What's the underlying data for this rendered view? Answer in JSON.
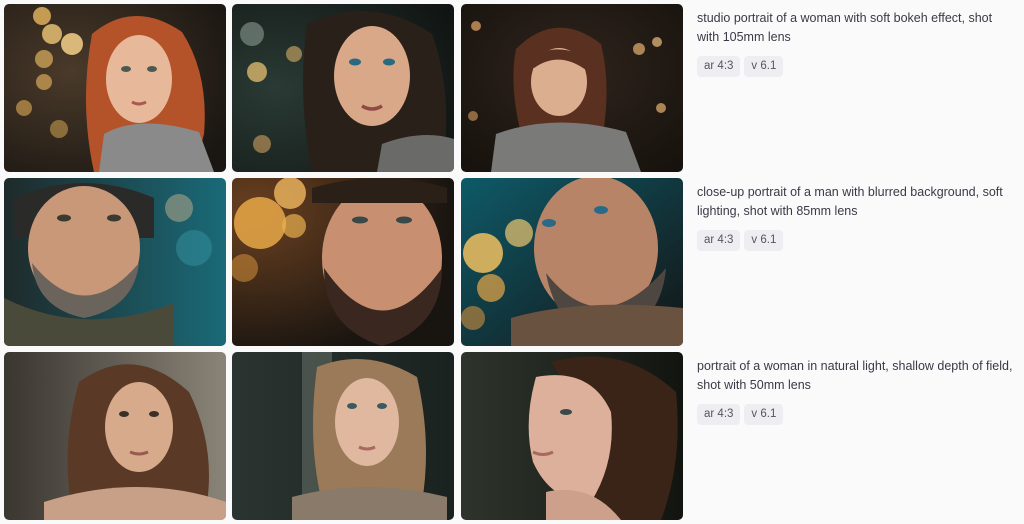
{
  "rows": [
    {
      "prompt": "studio portrait of a woman with soft bokeh effect, shot with 105mm lens",
      "tags": [
        "ar 4:3",
        "v 6.1"
      ]
    },
    {
      "prompt": "close-up portrait of a man with blurred background, soft lighting, shot with 85mm lens",
      "tags": [
        "ar 4:3",
        "v 6.1"
      ]
    },
    {
      "prompt": "portrait of a woman in natural light, shallow depth of field, shot with 50mm lens",
      "tags": [
        "ar 4:3",
        "v 6.1"
      ]
    }
  ]
}
